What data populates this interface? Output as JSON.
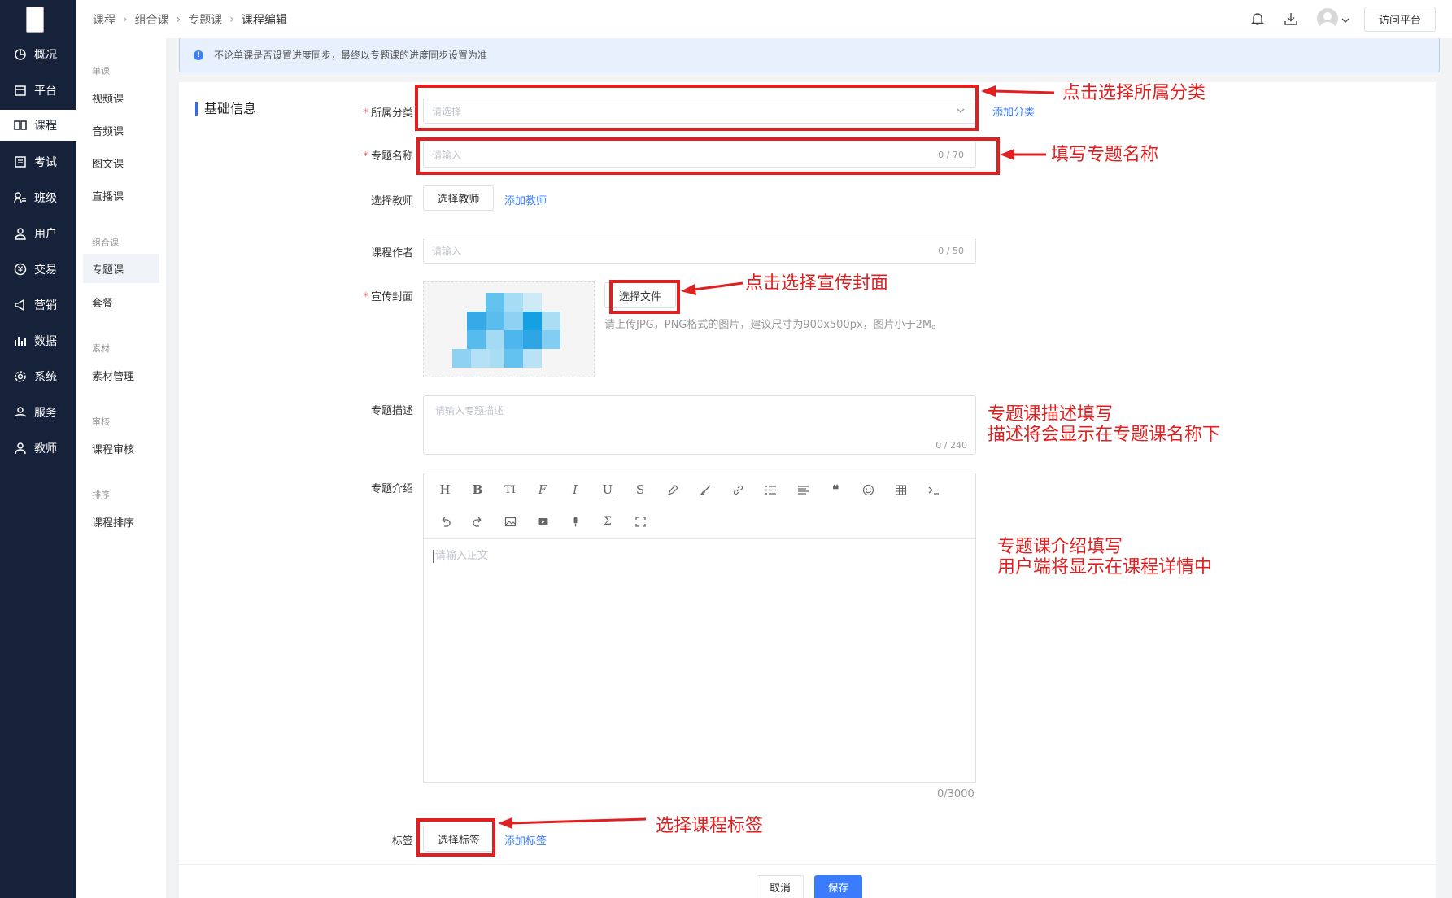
{
  "nav": {
    "items": [
      {
        "label": "概况",
        "icon": "dashboard-icon"
      },
      {
        "label": "平台",
        "icon": "store-icon"
      },
      {
        "label": "课程",
        "icon": "book-icon"
      },
      {
        "label": "考试",
        "icon": "exam-icon"
      },
      {
        "label": "班级",
        "icon": "class-icon"
      },
      {
        "label": "用户",
        "icon": "user-icon"
      },
      {
        "label": "交易",
        "icon": "yen-icon"
      },
      {
        "label": "营销",
        "icon": "megaphone-icon"
      },
      {
        "label": "数据",
        "icon": "bar-chart-icon"
      },
      {
        "label": "系统",
        "icon": "gear-icon"
      },
      {
        "label": "服务",
        "icon": "service-icon"
      },
      {
        "label": "教师",
        "icon": "teacher-icon"
      }
    ],
    "active": "课程"
  },
  "submenu": {
    "groups": [
      {
        "title": "单课",
        "items": [
          "视频课",
          "音频课",
          "图文课",
          "直播课"
        ]
      },
      {
        "title": "组合课",
        "items": [
          "专题课",
          "套餐"
        ]
      },
      {
        "title": "素材",
        "items": [
          "素材管理"
        ]
      },
      {
        "title": "审核",
        "items": [
          "课程审核"
        ]
      },
      {
        "title": "排序",
        "items": [
          "课程排序"
        ]
      }
    ],
    "active": "专题课"
  },
  "header": {
    "breadcrumb": [
      "课程",
      "组合课",
      "专题课",
      "课程编辑"
    ],
    "visit_button": "访问平台",
    "icons": [
      "bell-icon",
      "download-icon",
      "avatar",
      "chevron-down-icon"
    ]
  },
  "notice": "不论单课是否设置进度同步，最终以专题课的进度同步设置为准",
  "form": {
    "section_title": "基础信息",
    "category": {
      "label": "所属分类",
      "placeholder": "请选择",
      "add_link": "添加分类"
    },
    "name": {
      "label": "专题名称",
      "placeholder": "请输入",
      "count": "0 / 70"
    },
    "teacher": {
      "label": "选择教师",
      "button": "选择教师",
      "add_link": "添加教师"
    },
    "author": {
      "label": "课程作者",
      "placeholder": "请输入",
      "count": "0 / 50"
    },
    "cover": {
      "label": "宣传封面",
      "button": "选择文件",
      "hint": "请上传JPG，PNG格式的图片，建议尺寸为900x500px，图片小于2M。"
    },
    "description": {
      "label": "专题描述",
      "placeholder": "请输入专题描述",
      "count": "0 / 240"
    },
    "intro": {
      "label": "专题介绍",
      "placeholder": "请输入正文",
      "count": "0/3000",
      "toolbar_row1": [
        "H",
        "B",
        "TI",
        "F",
        "I",
        "U",
        "S",
        "pen-icon",
        "brush-icon",
        "link-icon",
        "list-icon",
        "align-icon",
        "quote-icon",
        "emoji-icon",
        "table-icon",
        "code-icon"
      ],
      "toolbar_row2": [
        "undo-icon",
        "redo-icon",
        "image-icon",
        "video-icon",
        "mic-icon",
        "sigma-icon",
        "fullscreen-icon"
      ]
    },
    "tags": {
      "label": "标签",
      "button": "选择标签",
      "add_link": "添加标签"
    }
  },
  "footer": {
    "cancel": "取消",
    "save": "保存"
  },
  "annotations": {
    "category": "点击选择所属分类",
    "name": "填写专题名称",
    "cover": "点击选择宣传封面",
    "description_line1": "专题课描述填写",
    "description_line2": "描述将会显示在专题课名称下",
    "intro_line1": "专题课介绍填写",
    "intro_line2": "用户端将显示在课程详情中",
    "tags": "选择课程标签"
  },
  "colors": {
    "nav_bg": "#16213a",
    "accent": "#3b7cff",
    "annotation": "#e02020",
    "required": "#f56c6c"
  }
}
